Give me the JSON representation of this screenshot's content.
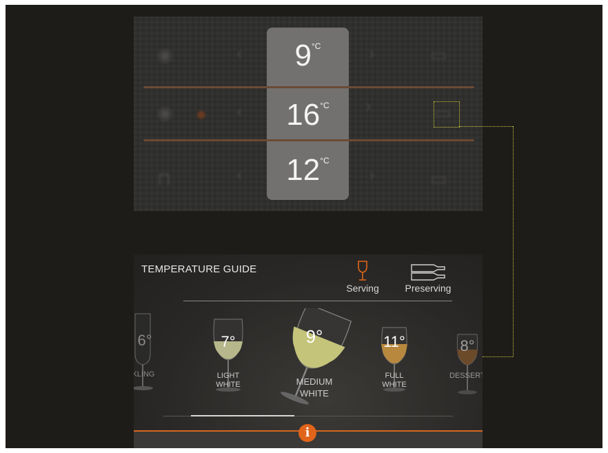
{
  "zones": [
    {
      "temp": "9",
      "unit": "°C"
    },
    {
      "temp": "16",
      "unit": "°C"
    },
    {
      "temp": "12",
      "unit": "°C"
    }
  ],
  "guide": {
    "title": "TEMPERATURE GUIDE",
    "modes": [
      {
        "label": "Serving",
        "icon": "wine-glass-icon",
        "active": true
      },
      {
        "label": "Preserving",
        "icon": "bottles-icon",
        "active": false
      }
    ],
    "wines": [
      {
        "temp": "6°",
        "label": "RKLING"
      },
      {
        "temp": "7°",
        "label_1": "LIGHT",
        "label_2": "WHITE"
      },
      {
        "temp": "9°",
        "label_1": "MEDIUM",
        "label_2": "WHITE"
      },
      {
        "temp": "11°",
        "label_1": "FULL",
        "label_2": "WHITE"
      },
      {
        "temp": "8°",
        "label": "DESSERT"
      }
    ],
    "info": "i"
  },
  "colors": {
    "accent": "#e0641a",
    "highlight": "#c9c93a",
    "panel": "#737170"
  }
}
